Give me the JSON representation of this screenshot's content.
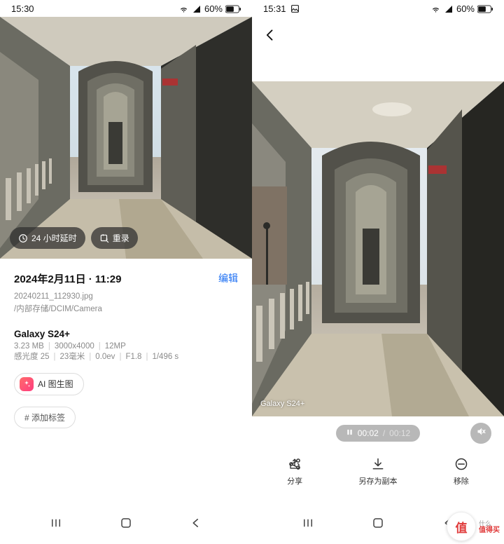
{
  "left": {
    "status": {
      "time": "15:30",
      "battery": "60%"
    },
    "pills": {
      "delay": "24 小时延时",
      "rerecord": "重录"
    },
    "datetime": "2024年2月11日 · 11:29",
    "edit": "编辑",
    "filename": "20240211_112930.jpg",
    "path": "/内部存储/DCIM/Camera",
    "device": "Galaxy S24+",
    "meta": {
      "size": "3.23 MB",
      "resolution": "3000x4000",
      "mp": "12MP",
      "iso_label": "感光度 25",
      "focal": "23毫米",
      "ev": "0.0ev",
      "aperture": "F1.8",
      "shutter": "1/496 s"
    },
    "ai_chip": "AI 图生图",
    "tag_chip": "# 添加标签"
  },
  "right": {
    "status": {
      "time": "15:31",
      "battery": "60%"
    },
    "watermark": "Galaxy S24+",
    "player": {
      "current": "00:02",
      "total": "00:12"
    },
    "actions": {
      "share": "分享",
      "save_copy": "另存为副本",
      "remove": "移除"
    }
  },
  "badge": {
    "char": "值",
    "line1": "什么",
    "line2": "值得买"
  }
}
